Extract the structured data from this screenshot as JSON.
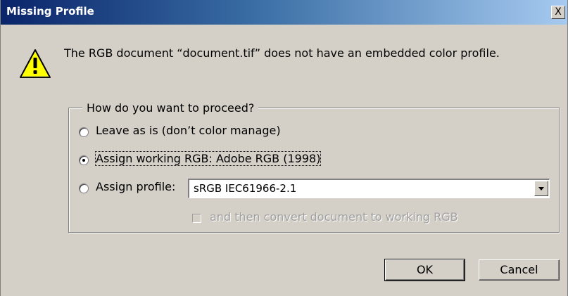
{
  "window": {
    "title": "Missing Profile",
    "close_glyph": "X"
  },
  "message": {
    "icon": "warning-icon",
    "text": "The RGB document “document.tif” does not have an embedded color profile."
  },
  "options": {
    "group_label": "How do you want to proceed?",
    "choices": [
      {
        "label": "Leave as is (don’t color manage)",
        "selected": false
      },
      {
        "label": "Assign working RGB:  Adobe RGB (1998)",
        "selected": true
      },
      {
        "label": "Assign profile:",
        "selected": false
      }
    ],
    "profile_select": {
      "value": "sRGB IEC61966-2.1"
    },
    "convert_checkbox": {
      "label": "and then convert document to working RGB",
      "checked": false,
      "enabled": false
    }
  },
  "buttons": {
    "ok_label": "OK",
    "cancel_label": "Cancel"
  },
  "colors": {
    "titlebar_start": "#0a246a",
    "titlebar_end": "#a6caf0",
    "dialog_bg": "#d4d0c8",
    "warning_fill": "#ffff00"
  }
}
